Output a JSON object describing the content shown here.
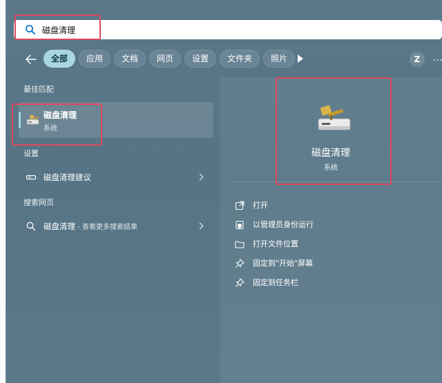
{
  "search": {
    "value": "磁盘清理",
    "placeholder": ""
  },
  "filters": {
    "chips": [
      {
        "label": "全部",
        "active": true
      },
      {
        "label": "应用"
      },
      {
        "label": "文档"
      },
      {
        "label": "网页"
      },
      {
        "label": "设置"
      },
      {
        "label": "文件夹"
      },
      {
        "label": "照片"
      }
    ],
    "user_initial": "Z",
    "more": "…"
  },
  "left": {
    "best_match_title": "最佳匹配",
    "best_match": {
      "name": "磁盘清理",
      "kind": "系统"
    },
    "settings_title": "设置",
    "settings_item": "磁盘清理建议",
    "web_title": "搜索网页",
    "web_item": {
      "query": "磁盘清理",
      "suffix": " - 查看更多搜索结果"
    }
  },
  "detail": {
    "name": "磁盘清理",
    "kind": "系统",
    "actions": [
      {
        "label": "打开",
        "icon": "open-external-icon"
      },
      {
        "label": "以管理员身份运行",
        "icon": "admin-shield-icon"
      },
      {
        "label": "打开文件位置",
        "icon": "folder-icon"
      },
      {
        "label": "固定到\"开始\"屏幕",
        "icon": "pin-icon"
      },
      {
        "label": "固定到任务栏",
        "icon": "pin-icon"
      }
    ]
  },
  "colors": {
    "panel": "#587687",
    "accent": "#a7d5e2",
    "highlight": "#e0495e"
  }
}
